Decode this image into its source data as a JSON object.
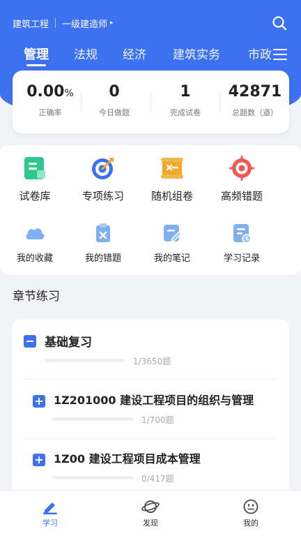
{
  "header": {
    "category": "建筑工程",
    "level": "一级建造师",
    "level_arrow": "▸",
    "search_icon": "search-icon",
    "menu_icon": "menu-icon"
  },
  "tabs": [
    {
      "label": "管理",
      "active": true
    },
    {
      "label": "法规",
      "active": false
    },
    {
      "label": "经济",
      "active": false
    },
    {
      "label": "建筑实务",
      "active": false
    },
    {
      "label": "市政",
      "active": false
    }
  ],
  "stats": [
    {
      "value": "0.00",
      "unit": "%",
      "label": "正确率"
    },
    {
      "value": "0",
      "label": "今日做题"
    },
    {
      "value": "1",
      "label": "完成试卷"
    },
    {
      "value": "42871",
      "label": "总题数（道）"
    }
  ],
  "features": {
    "row1": [
      {
        "label": "试卷库",
        "icon": "exam-library-icon",
        "color": "#2dc98a"
      },
      {
        "label": "专项练习",
        "icon": "target-practice-icon",
        "color": "#3c72f0"
      },
      {
        "label": "随机组卷",
        "icon": "random-paper-icon",
        "color": "#f5a623"
      },
      {
        "label": "高频错题",
        "icon": "frequent-mistakes-icon",
        "color": "#ee5a4f"
      }
    ],
    "row2": [
      {
        "label": "我的收藏",
        "icon": "cloud-favorites-icon",
        "color": "#7fb1f2"
      },
      {
        "label": "我的错题",
        "icon": "clipboard-mistakes-icon",
        "color": "#7fb1f2"
      },
      {
        "label": "我的笔记",
        "icon": "note-edit-icon",
        "color": "#7fb1f2"
      },
      {
        "label": "学习记录",
        "icon": "study-record-icon",
        "color": "#7fb1f2"
      }
    ]
  },
  "section_title": "章节练习",
  "chapters": [
    {
      "title": "基础复习",
      "progress": "1/3650题",
      "progress_fraction": 0.0003,
      "expanded": true
    },
    {
      "title": "1Z201000 建设工程项目的组织与管理",
      "progress": "1/700题",
      "progress_fraction": 0.0014,
      "expanded": false
    },
    {
      "title": "1Z00 建设工程项目成本管理",
      "progress": "0/417题",
      "progress_fraction": 0,
      "expanded": false
    }
  ],
  "bottom_nav": [
    {
      "label": "学习",
      "icon": "study-pen-icon",
      "active": true
    },
    {
      "label": "发现",
      "icon": "planet-icon",
      "active": false
    },
    {
      "label": "我的",
      "icon": "profile-face-icon",
      "active": false
    }
  ],
  "colors": {
    "accent": "#3c72f0",
    "background": "#f2f3f7"
  }
}
